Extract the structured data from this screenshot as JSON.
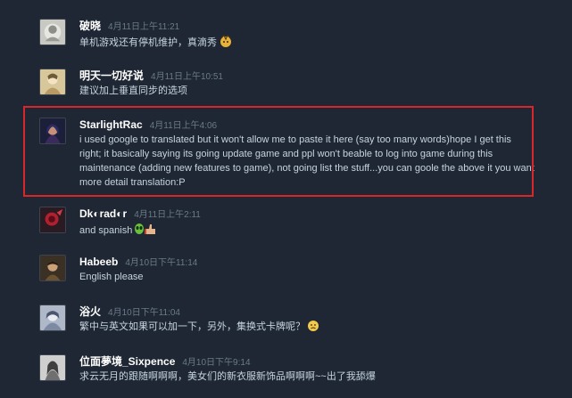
{
  "comments": [
    {
      "author": "破晓",
      "timestamp": "4月11日上午11:21",
      "text": "单机游戏还有停机维护，真滴秀",
      "emoji": "clapping-emoji-icon"
    },
    {
      "author": "明天一切好说",
      "timestamp": "4月11日上午10:51",
      "text": "建议加上垂直同步的选项"
    },
    {
      "author": "StarlightRac",
      "timestamp": "4月11日上午4:06",
      "text": "i used google to translated but it won't allow me to paste it here (say too many words)hope I get this right; it basically saying its going update game and ppl won't beable to log into game during this maintenance (adding new features to game), not going list the stuff...you can goole the above it you want more detail translation:P",
      "highlighted": true
    },
    {
      "author": "Dk◐rad◐r",
      "timestamp": "4月11日上午2:11",
      "text": "and spanish",
      "emoji": "alien-thumbs-up-emoji-icon"
    },
    {
      "author": "Habeeb",
      "timestamp": "4月10日下午11:14",
      "text": "English please"
    },
    {
      "author": "浴火",
      "timestamp": "4月10日下午11:04",
      "text": "繁中与英文如果可以加一下，另外，集换式卡牌呢？",
      "emoji": "worried-face-emoji-icon"
    },
    {
      "author": "位面夢境_Sixpence",
      "timestamp": "4月10日下午9:14",
      "text": "求云无月的跟随啊啊啊，美女们的新衣服新饰品啊啊啊~~出了我舔爆"
    }
  ],
  "colors": {
    "background": "#1e2733",
    "author": "#ffffff",
    "timestamp": "#6b7a88",
    "text": "#c6d4df",
    "highlight": "#d9262b"
  }
}
